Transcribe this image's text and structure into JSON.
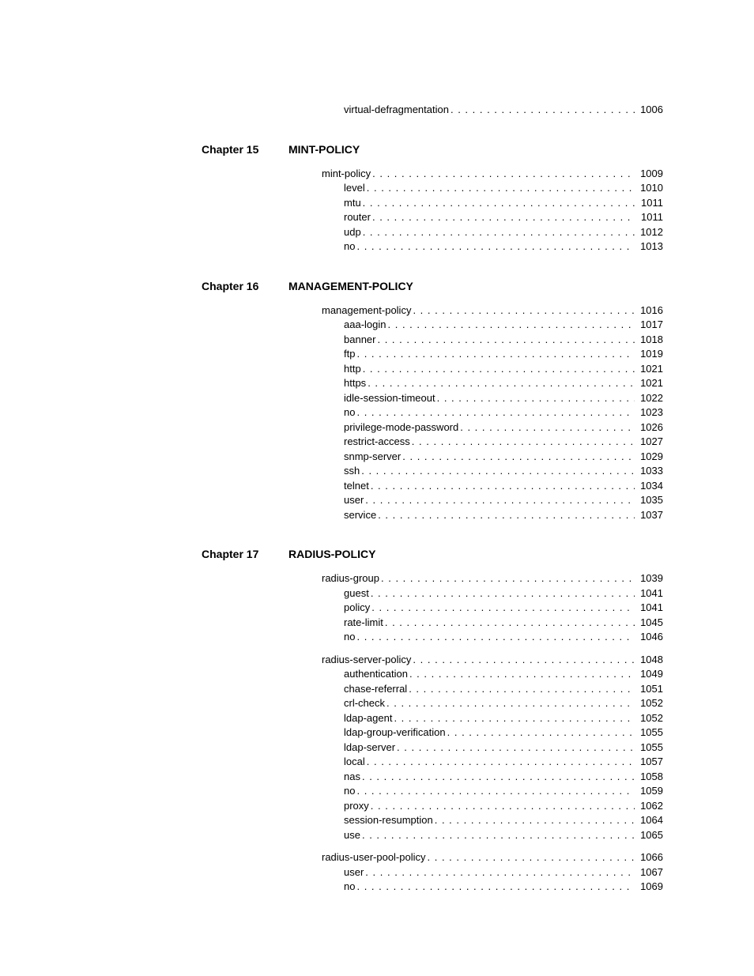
{
  "orphan_entries": [
    {
      "label": "virtual-defragmentation",
      "page": "1006",
      "level": 1
    }
  ],
  "chapters": [
    {
      "chapter_label": "Chapter 15",
      "chapter_title": "MINT-POLICY",
      "groups": [
        {
          "entries": [
            {
              "label": "mint-policy",
              "page": "1009",
              "level": 0
            },
            {
              "label": "level",
              "page": "1010",
              "level": 1
            },
            {
              "label": "mtu",
              "page": "1011",
              "level": 1
            },
            {
              "label": "router",
              "page": "1011",
              "level": 1
            },
            {
              "label": "udp",
              "page": "1012",
              "level": 1
            },
            {
              "label": "no",
              "page": "1013",
              "level": 1
            }
          ]
        }
      ]
    },
    {
      "chapter_label": "Chapter 16",
      "chapter_title": "MANAGEMENT-POLICY",
      "groups": [
        {
          "entries": [
            {
              "label": "management-policy",
              "page": "1016",
              "level": 0
            },
            {
              "label": "aaa-login",
              "page": "1017",
              "level": 1
            },
            {
              "label": "banner",
              "page": "1018",
              "level": 1
            },
            {
              "label": "ftp",
              "page": "1019",
              "level": 1
            },
            {
              "label": "http",
              "page": "1021",
              "level": 1
            },
            {
              "label": "https",
              "page": "1021",
              "level": 1
            },
            {
              "label": "idle-session-timeout",
              "page": "1022",
              "level": 1
            },
            {
              "label": "no",
              "page": "1023",
              "level": 1
            },
            {
              "label": "privilege-mode-password",
              "page": "1026",
              "level": 1
            },
            {
              "label": "restrict-access",
              "page": "1027",
              "level": 1
            },
            {
              "label": "snmp-server",
              "page": "1029",
              "level": 1
            },
            {
              "label": "ssh",
              "page": "1033",
              "level": 1
            },
            {
              "label": "telnet",
              "page": "1034",
              "level": 1
            },
            {
              "label": "user",
              "page": "1035",
              "level": 1
            },
            {
              "label": "service",
              "page": "1037",
              "level": 1
            }
          ]
        }
      ]
    },
    {
      "chapter_label": "Chapter 17",
      "chapter_title": "RADIUS-POLICY",
      "groups": [
        {
          "entries": [
            {
              "label": "radius-group",
              "page": "1039",
              "level": 0
            },
            {
              "label": "guest",
              "page": "1041",
              "level": 1
            },
            {
              "label": "policy",
              "page": "1041",
              "level": 1
            },
            {
              "label": "rate-limit",
              "page": "1045",
              "level": 1
            },
            {
              "label": "no",
              "page": "1046",
              "level": 1
            }
          ]
        },
        {
          "entries": [
            {
              "label": "radius-server-policy",
              "page": "1048",
              "level": 0
            },
            {
              "label": "authentication",
              "page": "1049",
              "level": 1
            },
            {
              "label": "chase-referral",
              "page": "1051",
              "level": 1
            },
            {
              "label": "crl-check",
              "page": "1052",
              "level": 1
            },
            {
              "label": "ldap-agent",
              "page": "1052",
              "level": 1
            },
            {
              "label": "ldap-group-verification",
              "page": "1055",
              "level": 1
            },
            {
              "label": "ldap-server",
              "page": "1055",
              "level": 1
            },
            {
              "label": "local",
              "page": "1057",
              "level": 1
            },
            {
              "label": "nas",
              "page": "1058",
              "level": 1
            },
            {
              "label": "no",
              "page": "1059",
              "level": 1
            },
            {
              "label": "proxy",
              "page": "1062",
              "level": 1
            },
            {
              "label": "session-resumption",
              "page": "1064",
              "level": 1
            },
            {
              "label": "use",
              "page": "1065",
              "level": 1
            }
          ]
        },
        {
          "entries": [
            {
              "label": "radius-user-pool-policy",
              "page": "1066",
              "level": 0
            },
            {
              "label": "user",
              "page": "1067",
              "level": 1
            },
            {
              "label": "no",
              "page": "1069",
              "level": 1
            }
          ]
        }
      ]
    }
  ]
}
